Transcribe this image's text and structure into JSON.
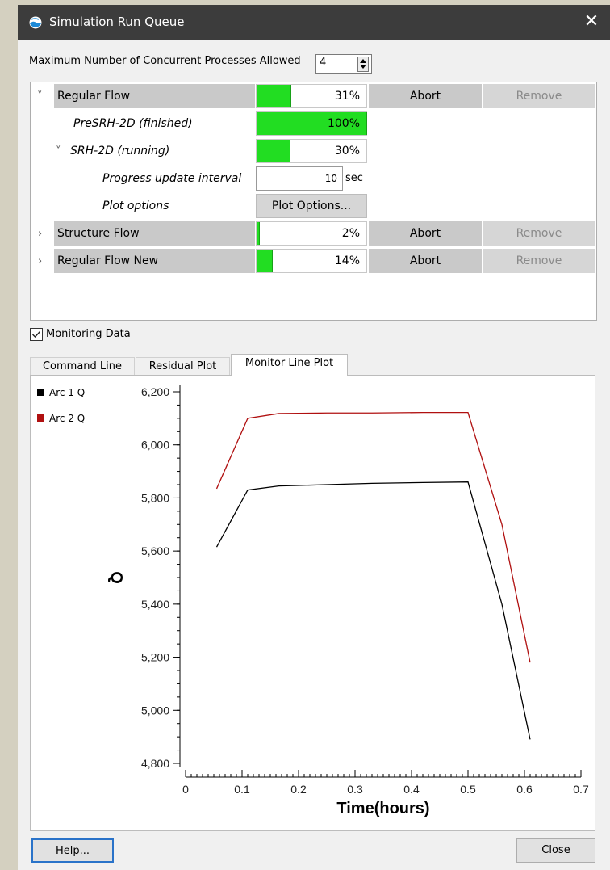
{
  "window": {
    "title": "Simulation Run Queue",
    "close_glyph": "✕",
    "icon": "app-logo-icon"
  },
  "max_processes": {
    "label": "Maximum Number of Concurrent Processes Allowed",
    "value": "4"
  },
  "queue": [
    {
      "name": "Regular Flow",
      "expander": "˅",
      "progress": 31,
      "progress_label": "31%",
      "abort": "Abort",
      "remove": "Remove"
    },
    {
      "name": "PreSRH-2D (finished)",
      "progress": 100,
      "progress_label": "100%"
    },
    {
      "name": "SRH-2D (running)",
      "expander": "˅",
      "progress": 30,
      "progress_label": "30%"
    },
    {
      "name": "Progress update interval",
      "value": "10",
      "unit": "sec"
    },
    {
      "name": "Plot options",
      "button": "Plot Options..."
    },
    {
      "name": "Structure Flow",
      "expander": "›",
      "progress": 2,
      "progress_label": "2%",
      "abort": "Abort",
      "remove": "Remove"
    },
    {
      "name": "Regular Flow New",
      "expander": "›",
      "progress": 14,
      "progress_label": "14%",
      "abort": "Abort",
      "remove": "Remove"
    }
  ],
  "monitoring": {
    "label": "Monitoring Data",
    "checked": true
  },
  "tabs": [
    {
      "label": "Command Line",
      "active": false
    },
    {
      "label": "Residual Plot",
      "active": false
    },
    {
      "label": "Monitor Line Plot",
      "active": true
    }
  ],
  "chart_data": {
    "type": "line",
    "xlabel": "Time(hours)",
    "ylabel": "Q",
    "xlim": [
      0,
      0.7
    ],
    "ylim": [
      4800,
      6200
    ],
    "x_ticks": [
      "0",
      "0.1",
      "0.2",
      "0.3",
      "0.4",
      "0.5",
      "0.6",
      "0.7"
    ],
    "y_ticks": [
      "6,200",
      "6,000",
      "5,800",
      "5,600",
      "5,400",
      "5,200",
      "5,000",
      "4,800"
    ],
    "y_tick_values": [
      6200,
      6000,
      5800,
      5600,
      5400,
      5200,
      5000,
      4800
    ],
    "legend_position": "left",
    "series": [
      {
        "name": "Arc 1 Q",
        "color": "#000000",
        "x": [
          0.055,
          0.11,
          0.165,
          0.25,
          0.33,
          0.42,
          0.5,
          0.56,
          0.61
        ],
        "y": [
          5615,
          5830,
          5845,
          5850,
          5855,
          5858,
          5860,
          5400,
          4890
        ]
      },
      {
        "name": "Arc 2 Q",
        "color": "#b01010",
        "x": [
          0.055,
          0.11,
          0.165,
          0.25,
          0.33,
          0.42,
          0.5,
          0.56,
          0.61
        ],
        "y": [
          5835,
          6100,
          6118,
          6120,
          6120,
          6122,
          6122,
          5700,
          5180
        ]
      }
    ]
  },
  "footer": {
    "help": "Help...",
    "close": "Close"
  }
}
